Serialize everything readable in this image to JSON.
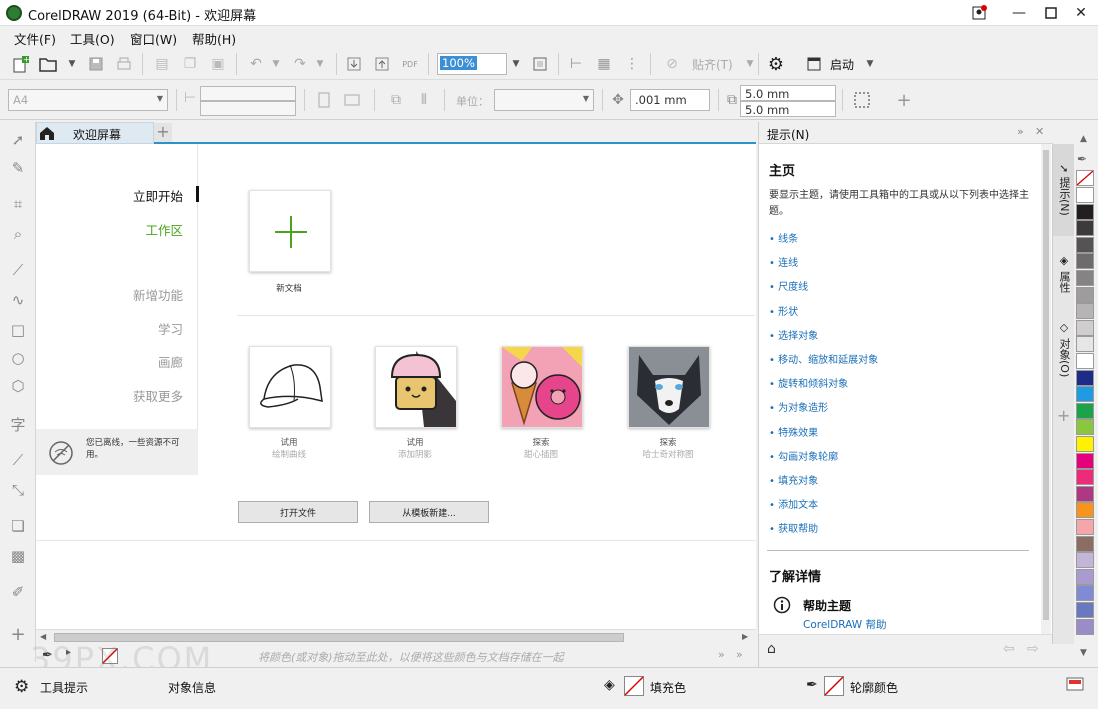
{
  "window": {
    "title": "CorelDRAW 2019 (64-Bit) - 欢迎屏幕"
  },
  "menu": [
    "文件(F)",
    "工具(O)",
    "窗口(W)",
    "帮助(H)"
  ],
  "toolbar1": {
    "zoom_value": "100%",
    "snap_label": "贴齐(T)",
    "launch_label": "启动"
  },
  "toolbar2": {
    "page_size": "A4",
    "units_label": "单位：",
    "nudge": ".001 mm",
    "dup_x": "5.0 mm",
    "dup_y": "5.0 mm"
  },
  "tab": {
    "label": "欢迎屏幕"
  },
  "welcome": {
    "nav": [
      "立即开始",
      "工作区",
      "新增功能",
      "学习",
      "画廊",
      "获取更多"
    ],
    "offline_text": "您已离线，一些资源不可用。",
    "new_doc_label": "新文档",
    "tiles": [
      {
        "title": "试用",
        "sub": "绘制曲线"
      },
      {
        "title": "试用",
        "sub": "添加阴影"
      },
      {
        "title": "探索",
        "sub": "甜心插图"
      },
      {
        "title": "探索",
        "sub": "哈士奇对称图"
      }
    ],
    "open_file_button": "打开文件",
    "from_template_button": "从模板新建..."
  },
  "color_tray_hint": "将颜色(或对象)拖动至此处，以便将这些颜色与文档存储在一起",
  "hints": {
    "header": "提示(N)",
    "home_title": "主页",
    "description": "要显示主题，请使用工具箱中的工具或从以下列表中选择主题。",
    "topics": [
      "线条",
      "连线",
      "尺度线",
      "形状",
      "选择对象",
      "移动、缩放和延展对象",
      "旋转和倾斜对象",
      "为对象造形",
      "特殊效果",
      "勾画对象轮廓",
      "填充对象",
      "添加文本",
      "获取帮助"
    ],
    "learn_more": "了解详情",
    "help_topics_label": "帮助主题",
    "help_link": "CorelDRAW 帮助"
  },
  "docker_tabs": [
    "提示(N)",
    "属性",
    "对象(O)"
  ],
  "palette_colors": [
    "#ffffff",
    "#231f20",
    "#3c3a3b",
    "#555355",
    "#6d6b6c",
    "#858384",
    "#9e9c9d",
    "#b6b4b5",
    "#cfcdce",
    "#e7e6e6",
    "#ffffff",
    "#1d2d87",
    "#1e9be2",
    "#1ba34a",
    "#8cc63f",
    "#fff200",
    "#e6007e",
    "#ee2a7b",
    "#b03883",
    "#f7941d",
    "#f4a6a8",
    "#8c6d62",
    "#c2b5d8",
    "#a89bd0",
    "#7f8bd4",
    "#6a78c2",
    "#9a8cc6"
  ],
  "status": {
    "tool_hint": "工具提示",
    "object_info": "对象信息",
    "fill_label": "填充色",
    "outline_label": "轮廓颜色"
  },
  "watermark": "39PX.COM"
}
